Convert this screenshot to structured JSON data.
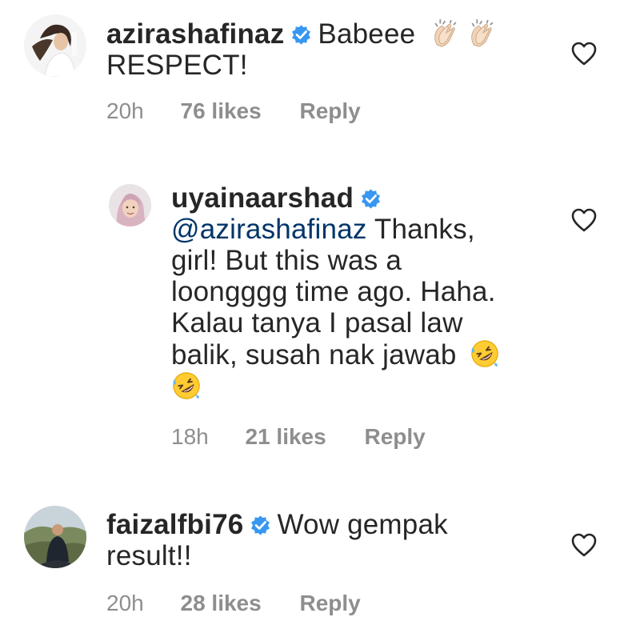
{
  "comments": [
    {
      "username": "azirashafinaz",
      "text": "Babeee",
      "text_line2": "RESPECT!",
      "emojis": [
        "clapping-hands",
        "clapping-hands"
      ],
      "time": "20h",
      "likes": "76 likes",
      "reply": "Reply",
      "verified": true,
      "liked": false
    },
    {
      "username": "uyainaarshad",
      "mention": "@azirashafinaz",
      "lines": [
        "Thanks,",
        "girl! But this was a",
        "loongggg time ago. Haha.",
        "Kalau tanya I pasal law",
        "balik, susah nak jawab"
      ],
      "emojis": [
        "rolling-on-floor-laughing",
        "rolling-on-floor-laughing"
      ],
      "time": "18h",
      "likes": "21 likes",
      "reply": "Reply",
      "verified": true,
      "liked": false
    },
    {
      "username": "faizalfbi76",
      "text": "Wow gempak",
      "text_line2": "result!!",
      "time": "20h",
      "likes": "28 likes",
      "reply": "Reply",
      "verified": true,
      "liked": false
    }
  ],
  "colors": {
    "text": "#262626",
    "meta": "#8e8e8e",
    "mention": "#003569",
    "verified": "#3897f0"
  }
}
